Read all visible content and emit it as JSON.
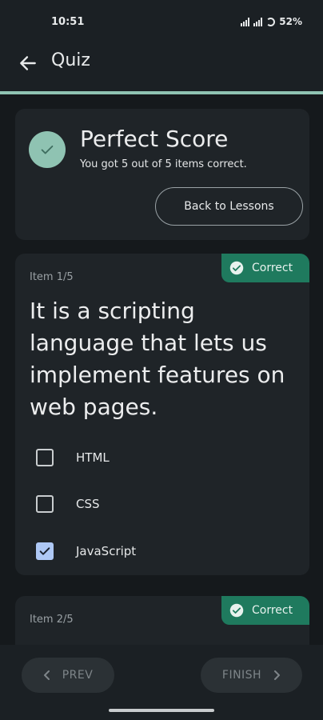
{
  "status_bar": {
    "time": "10:51",
    "battery": "52%"
  },
  "app_bar": {
    "title": "Quiz",
    "back_icon": "arrow-left-icon"
  },
  "score_card": {
    "title": "Perfect Score",
    "subtitle": "You got 5 out of 5 items correct.",
    "back_button": "Back to Lessons"
  },
  "items": [
    {
      "label": "Item 1/5",
      "badge": "Correct",
      "question": "It is a scripting language that lets us implement features on web pages.",
      "options": [
        {
          "text": "HTML",
          "checked": false
        },
        {
          "text": "CSS",
          "checked": false
        },
        {
          "text": "JavaScript",
          "checked": true
        }
      ]
    },
    {
      "label": "Item 2/5",
      "badge": "Correct"
    }
  ],
  "nav": {
    "prev": "PREV",
    "finish": "FINISH"
  },
  "colors": {
    "accent": "#8fc3b2",
    "badge": "#1f7a5e",
    "checkbox_checked": "#aec8f5",
    "background": "#15191c"
  }
}
